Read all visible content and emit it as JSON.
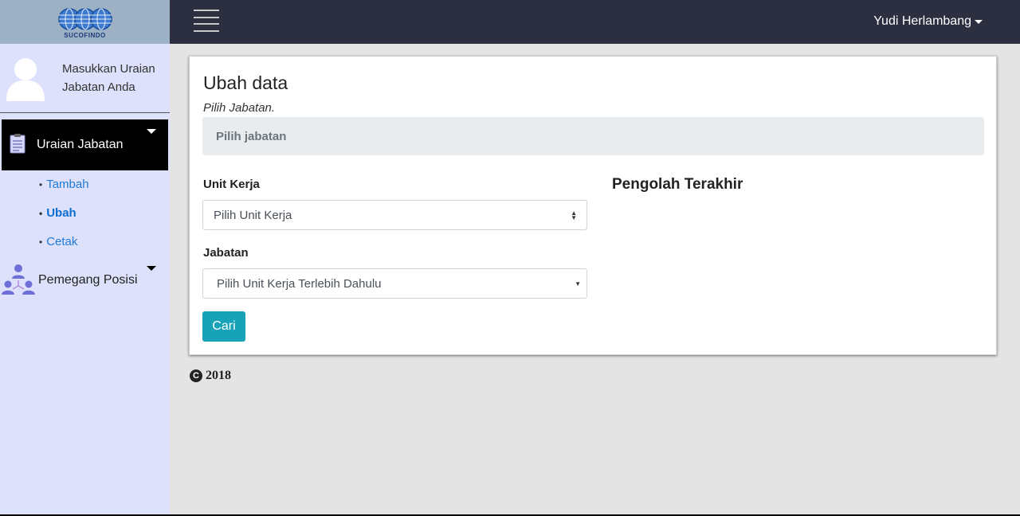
{
  "brand": {
    "logo_text": "SUCOFINDO"
  },
  "user_panel": {
    "line1": "Masukkan Uraian",
    "line2": "Jabatan Anda"
  },
  "sidebar": {
    "menu1": {
      "label": "Uraian Jabatan",
      "icon": "clipboard-icon"
    },
    "submenu": [
      {
        "label": "Tambah"
      },
      {
        "label": "Ubah",
        "active": true
      },
      {
        "label": "Cetak"
      }
    ],
    "menu2": {
      "label": "Pemegang Posisi",
      "icon": "org-chart-icon"
    }
  },
  "topbar": {
    "user_name": "Yudi Herlambang"
  },
  "card": {
    "title": "Ubah data",
    "subtitle": "Pilih Jabatan.",
    "pilih_bar": "Pilih jabatan",
    "unit_kerja_label": "Unit Kerja",
    "unit_kerja_value": "Pilih Unit Kerja",
    "jabatan_label": "Jabatan",
    "jabatan_value": "Pilih Unit Kerja Terlebih Dahulu",
    "button_label": "Cari",
    "right_heading": "Pengolah Terakhir"
  },
  "footer": {
    "year": "2018"
  },
  "colors": {
    "sidebar_bg": "#dde1fb",
    "topbar_bg": "#2b2f40",
    "accent": "#17a2b8",
    "link": "#1f7ad6"
  }
}
